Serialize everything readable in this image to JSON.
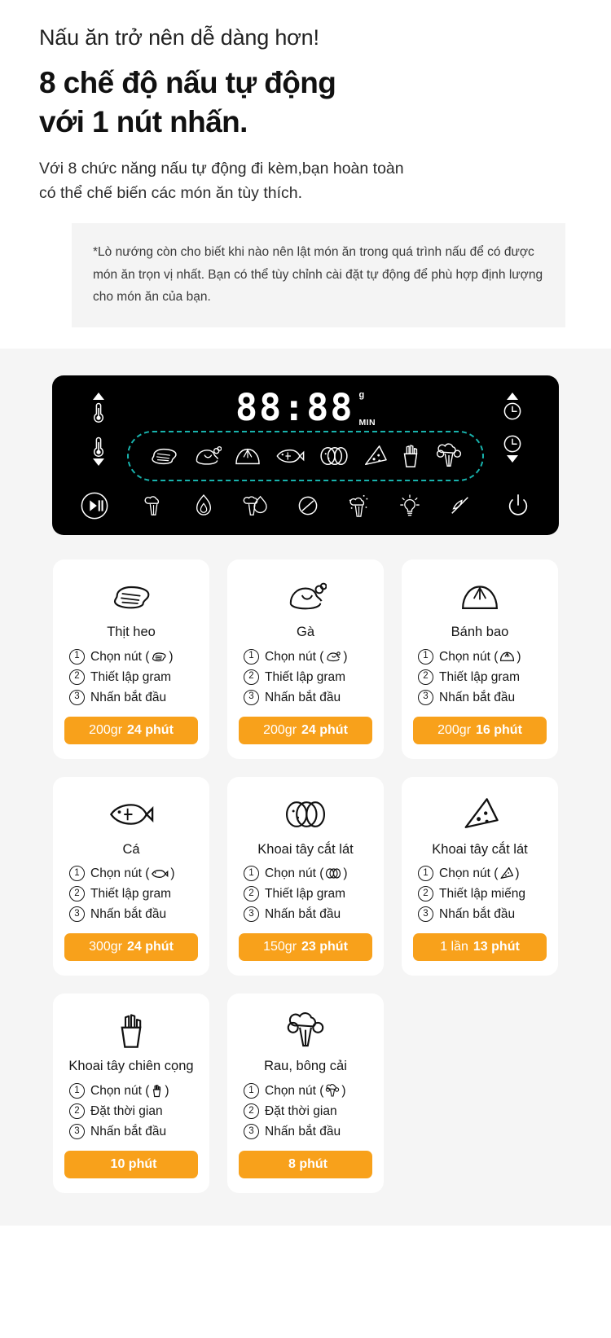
{
  "hero": {
    "kicker": "Nấu ăn trở nên dễ dàng hơn!",
    "title_line1": "8 chế độ nấu tự động",
    "title_line2": "với 1 nút nhấn.",
    "sub_line1": "Với 8 chức năng nấu tự động đi kèm,bạn hoàn toàn",
    "sub_line2": "có thể chế biến các món ăn tùy thích."
  },
  "note": {
    "text": "*Lò nướng còn cho biết khi nào nên lật món ăn trong quá trình nấu để có được món ăn trọn vị nhất. Bạn có thể tùy chỉnh cài đặt tự động để phù hợp định lượng  cho món ăn của bạn."
  },
  "panel": {
    "display_value": "88:88",
    "unit_weight": "g",
    "unit_time": "MIN",
    "accent_dashed": "#18b3ad",
    "background": "#000000",
    "left_controls": [
      {
        "name": "temperature-up-button",
        "icon": "thermometer-up-icon"
      },
      {
        "name": "temperature-down-button",
        "icon": "thermometer-down-icon"
      }
    ],
    "right_controls": [
      {
        "name": "time-up-button",
        "icon": "clock-up-icon"
      },
      {
        "name": "time-down-button",
        "icon": "clock-down-icon"
      }
    ],
    "mode_buttons": [
      {
        "name": "mode-steak-button",
        "icon": "steak-icon"
      },
      {
        "name": "mode-chicken-button",
        "icon": "chicken-icon"
      },
      {
        "name": "mode-bun-button",
        "icon": "bao-bun-icon"
      },
      {
        "name": "mode-fish-button",
        "icon": "fish-icon"
      },
      {
        "name": "mode-potato-slices-button",
        "icon": "potato-slices-icon"
      },
      {
        "name": "mode-pizza-button",
        "icon": "pizza-slice-icon"
      },
      {
        "name": "mode-fries-button",
        "icon": "fries-icon"
      },
      {
        "name": "mode-broccoli-button",
        "icon": "broccoli-icon"
      }
    ],
    "function_buttons": [
      {
        "name": "start-pause-button",
        "icon": "play-pause-icon"
      },
      {
        "name": "dehydrate-button",
        "icon": "broccoli-small-icon"
      },
      {
        "name": "roast-button",
        "icon": "flame-icon"
      },
      {
        "name": "grill-button",
        "icon": "flame-veg-icon"
      },
      {
        "name": "defrost-button",
        "icon": "no-entry-icon"
      },
      {
        "name": "steam-button",
        "icon": "steam-icon"
      },
      {
        "name": "light-button",
        "icon": "lightbulb-icon"
      },
      {
        "name": "mute-button",
        "icon": "mute-icon"
      },
      {
        "name": "power-button",
        "icon": "power-icon"
      }
    ]
  },
  "cards": [
    {
      "name": "card-pork",
      "icon": "steak-icon",
      "title": "Thịt heo",
      "steps": [
        {
          "num": "1",
          "text": "Chọn nút (",
          "text_end": ")",
          "icon": "steak-icon"
        },
        {
          "num": "2",
          "text": "Thiết lập gram"
        },
        {
          "num": "3",
          "text": "Nhấn bắt đầu"
        }
      ],
      "badge_qty": "200gr",
      "badge_time": "24 phút"
    },
    {
      "name": "card-chicken",
      "icon": "chicken-icon",
      "title": "Gà",
      "steps": [
        {
          "num": "1",
          "text": "Chọn nút (",
          "text_end": ")",
          "icon": "chicken-icon"
        },
        {
          "num": "2",
          "text": "Thiết lập gram"
        },
        {
          "num": "3",
          "text": "Nhấn bắt đầu"
        }
      ],
      "badge_qty": "200gr",
      "badge_time": "24 phút"
    },
    {
      "name": "card-bao-bun",
      "icon": "bao-bun-icon",
      "title": "Bánh bao",
      "steps": [
        {
          "num": "1",
          "text": "Chọn nút (",
          "text_end": ")",
          "icon": "bao-bun-icon"
        },
        {
          "num": "2",
          "text": "Thiết lập gram"
        },
        {
          "num": "3",
          "text": "Nhấn bắt đầu"
        }
      ],
      "badge_qty": "200gr",
      "badge_time": "16 phút"
    },
    {
      "name": "card-fish",
      "icon": "fish-icon",
      "title": "Cá",
      "steps": [
        {
          "num": "1",
          "text": "Chọn nút (",
          "text_end": ")",
          "icon": "fish-icon"
        },
        {
          "num": "2",
          "text": "Thiết lập gram"
        },
        {
          "num": "3",
          "text": "Nhấn bắt đầu"
        }
      ],
      "badge_qty": "300gr",
      "badge_time": "24 phút"
    },
    {
      "name": "card-potato-slices",
      "icon": "potato-slices-icon",
      "title": "Khoai tây cắt lát",
      "steps": [
        {
          "num": "1",
          "text": "Chọn nút (",
          "text_end": ")",
          "icon": "potato-slices-icon"
        },
        {
          "num": "2",
          "text": "Thiết lập gram"
        },
        {
          "num": "3",
          "text": "Nhấn bắt đầu"
        }
      ],
      "badge_qty": "150gr",
      "badge_time": "23 phút"
    },
    {
      "name": "card-pizza",
      "icon": "pizza-slice-icon",
      "title": "Khoai tây cắt lát",
      "steps": [
        {
          "num": "1",
          "text": "Chọn nút (",
          "text_end": ")",
          "icon": "pizza-slice-icon"
        },
        {
          "num": "2",
          "text": "Thiết lập miếng"
        },
        {
          "num": "3",
          "text": "Nhấn bắt đầu"
        }
      ],
      "badge_qty": "1 lần",
      "badge_time": "13 phút"
    },
    {
      "name": "card-fries",
      "icon": "fries-icon",
      "title": "Khoai tây chiên cọng",
      "steps": [
        {
          "num": "1",
          "text": "Chọn nút (",
          "text_end": ")",
          "icon": "fries-icon"
        },
        {
          "num": "2",
          "text": "Đặt thời gian"
        },
        {
          "num": "3",
          "text": "Nhấn bắt đầu"
        }
      ],
      "badge_qty": "",
      "badge_time": "10 phút"
    },
    {
      "name": "card-broccoli",
      "icon": "broccoli-icon",
      "title": "Rau, bông cải",
      "steps": [
        {
          "num": "1",
          "text": "Chọn nút (",
          "text_end": ")",
          "icon": "broccoli-icon"
        },
        {
          "num": "2",
          "text": "Đặt thời gian"
        },
        {
          "num": "3",
          "text": "Nhấn bắt đầu"
        }
      ],
      "badge_qty": "",
      "badge_time": "8 phút"
    }
  ],
  "colors": {
    "badge_orange": "#F8A11B",
    "panel_black": "#000000",
    "teal_dash": "#18b3ad",
    "grey_bg": "#f5f5f5",
    "note_bg": "#f4f4f4"
  }
}
